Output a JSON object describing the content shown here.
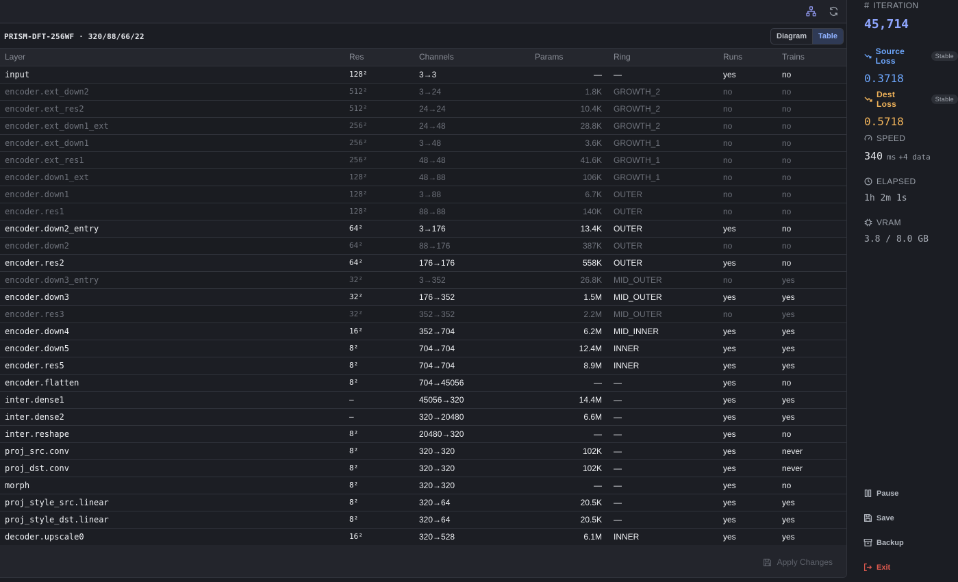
{
  "header": {
    "model_title": "PRISM-DFT-256WF · 320/88/66/22",
    "view_toggle": {
      "diagram_label": "Diagram",
      "table_label": "Table",
      "active": "Table"
    }
  },
  "table": {
    "columns": [
      "Layer",
      "Res",
      "Channels",
      "Params",
      "Ring",
      "Runs",
      "Trains"
    ],
    "rows": [
      {
        "layer": "input",
        "res": "128²",
        "channels": "3→3",
        "params": "—",
        "ring": "—",
        "runs": "yes",
        "trains": "no",
        "active": true
      },
      {
        "layer": "encoder.ext_down2",
        "res": "512²",
        "channels": "3→24",
        "params": "1.8K",
        "ring": "GROWTH_2",
        "runs": "no",
        "trains": "no",
        "active": false
      },
      {
        "layer": "encoder.ext_res2",
        "res": "512²",
        "channels": "24→24",
        "params": "10.4K",
        "ring": "GROWTH_2",
        "runs": "no",
        "trains": "no",
        "active": false
      },
      {
        "layer": "encoder.ext_down1_ext",
        "res": "256²",
        "channels": "24→48",
        "params": "28.8K",
        "ring": "GROWTH_2",
        "runs": "no",
        "trains": "no",
        "active": false
      },
      {
        "layer": "encoder.ext_down1",
        "res": "256²",
        "channels": "3→48",
        "params": "3.6K",
        "ring": "GROWTH_1",
        "runs": "no",
        "trains": "no",
        "active": false
      },
      {
        "layer": "encoder.ext_res1",
        "res": "256²",
        "channels": "48→48",
        "params": "41.6K",
        "ring": "GROWTH_1",
        "runs": "no",
        "trains": "no",
        "active": false
      },
      {
        "layer": "encoder.down1_ext",
        "res": "128²",
        "channels": "48→88",
        "params": "106K",
        "ring": "GROWTH_1",
        "runs": "no",
        "trains": "no",
        "active": false
      },
      {
        "layer": "encoder.down1",
        "res": "128²",
        "channels": "3→88",
        "params": "6.7K",
        "ring": "OUTER",
        "runs": "no",
        "trains": "no",
        "active": false
      },
      {
        "layer": "encoder.res1",
        "res": "128²",
        "channels": "88→88",
        "params": "140K",
        "ring": "OUTER",
        "runs": "no",
        "trains": "no",
        "active": false
      },
      {
        "layer": "encoder.down2_entry",
        "res": "64²",
        "channels": "3→176",
        "params": "13.4K",
        "ring": "OUTER",
        "runs": "yes",
        "trains": "no",
        "active": true
      },
      {
        "layer": "encoder.down2",
        "res": "64²",
        "channels": "88→176",
        "params": "387K",
        "ring": "OUTER",
        "runs": "no",
        "trains": "no",
        "active": false
      },
      {
        "layer": "encoder.res2",
        "res": "64²",
        "channels": "176→176",
        "params": "558K",
        "ring": "OUTER",
        "runs": "yes",
        "trains": "no",
        "active": true
      },
      {
        "layer": "encoder.down3_entry",
        "res": "32²",
        "channels": "3→352",
        "params": "26.8K",
        "ring": "MID_OUTER",
        "runs": "no",
        "trains": "yes",
        "active": false
      },
      {
        "layer": "encoder.down3",
        "res": "32²",
        "channels": "176→352",
        "params": "1.5M",
        "ring": "MID_OUTER",
        "runs": "yes",
        "trains": "yes",
        "active": true
      },
      {
        "layer": "encoder.res3",
        "res": "32²",
        "channels": "352→352",
        "params": "2.2M",
        "ring": "MID_OUTER",
        "runs": "no",
        "trains": "yes",
        "active": false
      },
      {
        "layer": "encoder.down4",
        "res": "16²",
        "channels": "352→704",
        "params": "6.2M",
        "ring": "MID_INNER",
        "runs": "yes",
        "trains": "yes",
        "active": true
      },
      {
        "layer": "encoder.down5",
        "res": "8²",
        "channels": "704→704",
        "params": "12.4M",
        "ring": "INNER",
        "runs": "yes",
        "trains": "yes",
        "active": true
      },
      {
        "layer": "encoder.res5",
        "res": "8²",
        "channels": "704→704",
        "params": "8.9M",
        "ring": "INNER",
        "runs": "yes",
        "trains": "yes",
        "active": true
      },
      {
        "layer": "encoder.flatten",
        "res": "8²",
        "channels": "704→45056",
        "params": "—",
        "ring": "—",
        "runs": "yes",
        "trains": "no",
        "active": true
      },
      {
        "layer": "inter.dense1",
        "res": "—",
        "channels": "45056→320",
        "params": "14.4M",
        "ring": "—",
        "runs": "yes",
        "trains": "yes",
        "active": true
      },
      {
        "layer": "inter.dense2",
        "res": "—",
        "channels": "320→20480",
        "params": "6.6M",
        "ring": "—",
        "runs": "yes",
        "trains": "yes",
        "active": true
      },
      {
        "layer": "inter.reshape",
        "res": "8²",
        "channels": "20480→320",
        "params": "—",
        "ring": "—",
        "runs": "yes",
        "trains": "no",
        "active": true
      },
      {
        "layer": "proj_src.conv",
        "res": "8²",
        "channels": "320→320",
        "params": "102K",
        "ring": "—",
        "runs": "yes",
        "trains": "never",
        "active": true
      },
      {
        "layer": "proj_dst.conv",
        "res": "8²",
        "channels": "320→320",
        "params": "102K",
        "ring": "—",
        "runs": "yes",
        "trains": "never",
        "active": true
      },
      {
        "layer": "morph",
        "res": "8²",
        "channels": "320→320",
        "params": "—",
        "ring": "—",
        "runs": "yes",
        "trains": "no",
        "active": true
      },
      {
        "layer": "proj_style_src.linear",
        "res": "8²",
        "channels": "320→64",
        "params": "20.5K",
        "ring": "—",
        "runs": "yes",
        "trains": "yes",
        "active": true
      },
      {
        "layer": "proj_style_dst.linear",
        "res": "8²",
        "channels": "320→64",
        "params": "20.5K",
        "ring": "—",
        "runs": "yes",
        "trains": "yes",
        "active": true
      },
      {
        "layer": "decoder.upscale0",
        "res": "16²",
        "channels": "320→528",
        "params": "6.1M",
        "ring": "INNER",
        "runs": "yes",
        "trains": "yes",
        "active": true
      }
    ]
  },
  "footer": {
    "apply_label": "Apply Changes"
  },
  "sidebar": {
    "iteration": {
      "label": "ITERATION",
      "value": "45,714",
      "color": "#8fa6ff"
    },
    "source_loss": {
      "label": "Source Loss",
      "badge": "Stable",
      "value": "0.3718",
      "color": "#6ea8ff"
    },
    "dest_loss": {
      "label": "Dest Loss",
      "badge": "Stable",
      "value": "0.5718",
      "color": "#f0b35a"
    },
    "speed": {
      "label": "SPEED",
      "value": "340",
      "unit": "ms",
      "extra": "+4 data"
    },
    "elapsed": {
      "label": "ELAPSED",
      "value": "1h 2m 1s"
    },
    "vram": {
      "label": "VRAM",
      "value": "3.8 / 8.0 GB"
    },
    "actions": {
      "pause": "Pause",
      "save": "Save",
      "backup": "Backup",
      "exit": "Exit"
    },
    "exit_color": "#e05a4f"
  }
}
